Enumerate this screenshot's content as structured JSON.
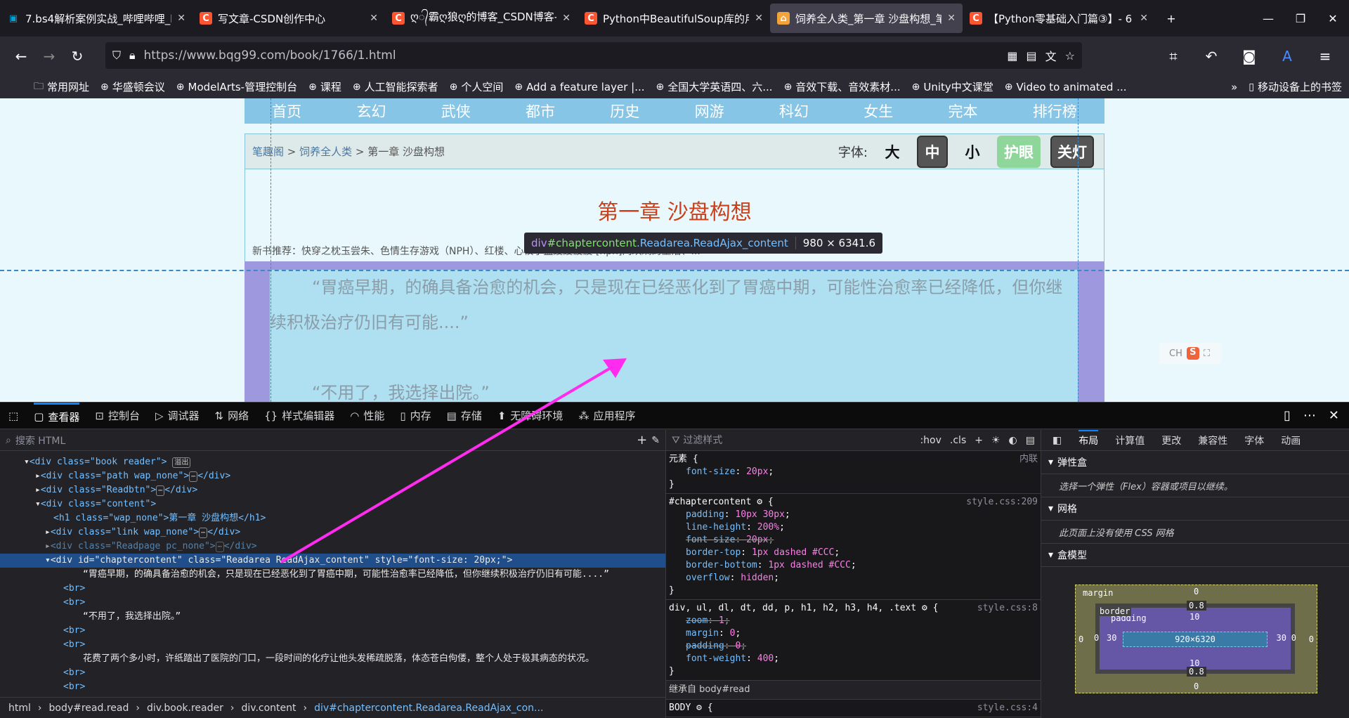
{
  "browser": {
    "tabs": [
      {
        "title": "7.bs4解析案例实战_哔哩哔哩_b",
        "icon": "bilibili-icon"
      },
      {
        "title": "写文章-CSDN创作中心",
        "icon": "csdn-icon"
      },
      {
        "title": "ღ᭄霸ღ狼ღ的博客_CSDN博客-U",
        "icon": "csdn-icon"
      },
      {
        "title": "Python中BeautifulSoup库的用",
        "icon": "csdn-icon"
      },
      {
        "title": "饲养全人类_第一章 沙盘构想_笔",
        "icon": "site-icon",
        "active": true
      },
      {
        "title": "【Python零基础入门篇③】- 6",
        "icon": "csdn-icon"
      }
    ],
    "url": "https://www.bqg99.com/book/1766/1.html",
    "bookmarks": [
      "常用网址",
      "华盛顿会议",
      "ModelArts-管理控制台",
      "课程",
      "人工智能探索者",
      "个人空间",
      "Add a feature layer |...",
      "全国大学英语四、六...",
      "音效下载、音效素材...",
      "Unity中文课堂",
      "Video to animated ..."
    ],
    "mobile_bookmarks": "移动设备上的书签"
  },
  "site": {
    "nav": [
      "首页",
      "玄幻",
      "武侠",
      "都市",
      "历史",
      "网游",
      "科幻",
      "女生",
      "完本",
      "排行榜"
    ],
    "breadcrumb": [
      "笔趣阁",
      "饲养全人类",
      "第一章 沙盘构想"
    ],
    "font_label": "字体:",
    "font_sizes": [
      "大",
      "中",
      "小"
    ],
    "eye_care": "护眼",
    "lights_off": "关灯",
    "chapter_title": "第一章 沙盘构想",
    "recommend": "新书推荐：快穿之枕玉尝朱、色情生存游戏（NPH）、红楼、心校小盘废废疲疲 [nph]网欢斓的生活、...",
    "paragraphs": [
      "“胃癌早期，的确具备治愈的机会，只是现在已经恶化到了胃癌中期，可能性治愈率已经降低，但你继续积极治疗仍旧有可能....”",
      "“不用了，我选择出院。”"
    ],
    "ime": "CH"
  },
  "tooltip": {
    "tag": "div",
    "id": "#chaptercontent",
    "classes": ".Readarea.ReadAjax_content",
    "size": "980 × 6341.6"
  },
  "devtools": {
    "tabs": [
      "查看器",
      "控制台",
      "调试器",
      "网络",
      "样式编辑器",
      "性能",
      "内存",
      "存储",
      "无障碍环境",
      "应用程序"
    ],
    "search_placeholder": "搜索 HTML",
    "tree": {
      "book": "<div class=\"book reader\">",
      "overflow_badge": "溢出",
      "path": "<div class=\"path wap_none\">",
      "readbtn": "<div class=\"Readbtn\">",
      "content": "<div class=\"content\">",
      "h1": "<h1 class=\"wap_none\">第一章 沙盘构想</h1>",
      "link": "<div class=\"link wap_none\">",
      "readpage": "<div class=\"Readpage pc_none\">",
      "selected": "<div id=\"chaptercontent\" class=\"Readarea ReadAjax_content\" style=\"font-size: 20px;\">",
      "close_div": "</div>",
      "br": "<br>",
      "text1": "“胃癌早期，的确具备治愈的机会，只是现在已经恶化到了胃癌中期，可能性治愈率已经降低，但你继续积极治疗仍旧有可能....”",
      "text2": "“不用了，我选择出院。”",
      "text3": "花费了两个多小时，许纸踏出了医院的门口，一段时间的化疗让他头发稀疏脱落，体态苍白佝偻，整个人处于极其病态的状况。"
    },
    "breadcrumbs": [
      "html",
      "body#read.read",
      "div.book.reader",
      "div.content",
      "div#chaptercontent.Readarea.ReadAjax_con..."
    ],
    "styles": {
      "filter_placeholder": "过滤样式",
      "hov": ":hov",
      "cls": ".cls",
      "element_selector": "元素 {",
      "inline": "内联",
      "r0": [
        [
          "font-size",
          "20px"
        ]
      ],
      "r1_selector": "#chaptercontent",
      "r1_src": "style.css:209",
      "r1": [
        [
          "padding",
          "10px 30px"
        ],
        [
          "line-height",
          "200%"
        ],
        [
          "font-size",
          "20px",
          "strike"
        ],
        [
          "border-top",
          "1px dashed #CCC"
        ],
        [
          "border-bottom",
          "1px dashed #CCC"
        ],
        [
          "overflow",
          "hidden"
        ]
      ],
      "r2_selector": "div, ul, dl, dt, dd, p, h1, h2, h3, h4, .text",
      "r2_src": "style.css:8",
      "r2": [
        [
          "zoom",
          "1",
          "strike"
        ],
        [
          "margin",
          "0"
        ],
        [
          "padding",
          "0",
          "strike"
        ],
        [
          "font-weight",
          "400"
        ]
      ],
      "inherited": "继承自 body#read",
      "r3_selector": "BODY",
      "r3_src": "style.css:4"
    },
    "layout": {
      "tabs": [
        "布局",
        "计算值",
        "更改",
        "兼容性",
        "字体",
        "动画"
      ],
      "flex_title": "弹性盒",
      "flex_note": "选择一个弹性（Flex）容器或项目以继续。",
      "grid_title": "网格",
      "grid_note": "此页面上没有使用 CSS 网格",
      "box_title": "盒模型",
      "box": {
        "margin_label": "margin",
        "border_label": "border",
        "padding_label": "padding",
        "margin": [
          "0",
          "0",
          "0",
          "0"
        ],
        "border": [
          "0.8",
          "0",
          "0.8",
          "0"
        ],
        "padding": [
          "10",
          "30",
          "10",
          "30"
        ],
        "content": "920×6320"
      }
    }
  },
  "colors": {
    "highlight_margin": "#9e98df",
    "highlight_content": "#afe0f2",
    "accent": "#0a84ff",
    "arrow": "#ff2cf0"
  }
}
